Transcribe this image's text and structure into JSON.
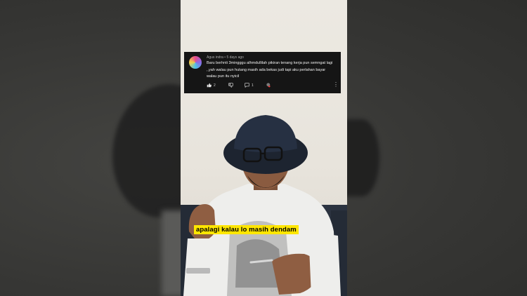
{
  "comment": {
    "author": "Agus indra",
    "separator": "•",
    "time": "5 days ago",
    "text": "Baru berhnti 3mingggu alhmdullilah pikiran tenang kerja pun semngat lagi ,,yah walau pun hutang masih ada bekas judi tapi aku perlahan bayar walau pun itu nyicil",
    "likes": "2",
    "replies": "1"
  },
  "caption": "apalagi kalau lo masih dendam",
  "colors": {
    "comment_bg": "#151515",
    "caption_bg": "#ffe600",
    "wall": "#e8e4dc"
  }
}
